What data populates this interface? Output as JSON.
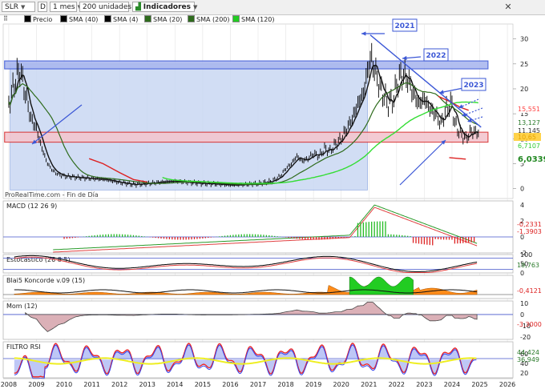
{
  "toolbar": {
    "symbol": "SLR",
    "d_label": "D",
    "period": "1 mes",
    "units": "200 unidades",
    "indicators": "Indicadores"
  },
  "legend": [
    {
      "label": "Precio",
      "color": "#000000"
    },
    {
      "label": "SMA (40)",
      "color": "#000000"
    },
    {
      "label": "SMA (4)",
      "color": "#000000"
    },
    {
      "label": "SMA (20)",
      "color": "#2e6b1c"
    },
    {
      "label": "SMA (200)",
      "color": "#2e6b1c"
    },
    {
      "label": "SMA (120)",
      "color": "#22cc22"
    }
  ],
  "watermark": "ProRealTime.com - Fin de Día",
  "annotations": [
    "2021",
    "2022",
    "2023"
  ],
  "chart_data": [
    {
      "type": "line",
      "name": "price",
      "ylim": [
        -2,
        33
      ],
      "yticks": [
        0,
        5,
        10,
        15,
        20,
        25,
        30
      ],
      "x": [
        2008.0,
        2008.2,
        2008.4,
        2008.6,
        2008.8,
        2009.0,
        2009.2,
        2009.4,
        2009.6,
        2009.8,
        2010.0,
        2010.5,
        2011.0,
        2011.5,
        2012.0,
        2012.5,
        2013.0,
        2013.5,
        2014.0,
        2014.5,
        2015.0,
        2015.5,
        2016.0,
        2016.5,
        2017.0,
        2017.5,
        2017.8,
        2018.0,
        2018.2,
        2018.4,
        2018.6,
        2018.8,
        2019.0,
        2019.2,
        2019.4,
        2019.6,
        2019.8,
        2020.0,
        2020.2,
        2020.4,
        2020.6,
        2020.8,
        2020.9,
        2021.0,
        2021.1,
        2021.3,
        2021.5,
        2021.7,
        2021.9,
        2022.0,
        2022.2,
        2022.4,
        2022.6,
        2022.8,
        2023.0,
        2023.2,
        2023.4,
        2023.6,
        2023.8,
        2024.0,
        2024.1,
        2024.3,
        2024.5,
        2024.7,
        2024.9
      ],
      "price": [
        17,
        21,
        24,
        19,
        14,
        12,
        8,
        5,
        3.5,
        2.8,
        2.5,
        2.2,
        2.0,
        1.8,
        1.2,
        0.8,
        1.0,
        1.3,
        1.5,
        1.2,
        1.0,
        0.9,
        0.7,
        0.8,
        1.0,
        1.5,
        2.5,
        4,
        5,
        6.5,
        5.5,
        6,
        7,
        6.5,
        8,
        7.5,
        9,
        10,
        12,
        14,
        17,
        19,
        22,
        25,
        26,
        22,
        19,
        17,
        18,
        21,
        23,
        22,
        19,
        17,
        18,
        16,
        15,
        13,
        16,
        17,
        13,
        11,
        10,
        11.5,
        11.2
      ],
      "value_labels_right": [
        "15,551",
        "13,127",
        "11,145",
        "10,65",
        "6,7107",
        "6,0339"
      ],
      "arrow_labels": []
    },
    {
      "type": "bar",
      "name": "MACD (12 26 9)",
      "ylim": [
        -2,
        4.5
      ],
      "yticks": [
        4,
        2,
        0,
        -2
      ],
      "value_labels_right": [
        "-0,2331",
        "-1,3903"
      ]
    },
    {
      "type": "line",
      "name": "Estocástico (26 8 5)",
      "ylim": [
        0,
        100
      ],
      "yticks": [
        100,
        50,
        0
      ],
      "value_labels_right": [
        "19,763"
      ]
    },
    {
      "type": "area",
      "name": "Blai5 Koncorde v.09 (15)",
      "value_labels_right": [
        "-0,4121"
      ]
    },
    {
      "type": "area",
      "name": "Mom (12)",
      "ylim": [
        -22,
        12
      ],
      "yticks": [
        10,
        0,
        -10,
        -20
      ],
      "value_labels_right": [
        "-3,3000"
      ]
    },
    {
      "type": "line",
      "name": "FILTRO RSI",
      "ylim": [
        10,
        85
      ],
      "yticks": [
        60,
        40,
        20
      ],
      "value_labels_right": [
        "44,424",
        "36,949"
      ]
    }
  ],
  "x_axis": [
    "2008",
    "2009",
    "2010",
    "2011",
    "2012",
    "2013",
    "2014",
    "2015",
    "2016",
    "2017",
    "2018",
    "2019",
    "2020",
    "2021",
    "2022",
    "2023",
    "2024",
    "2025",
    "2026"
  ],
  "y_axis_labels": {
    "macd": [
      "4",
      "2",
      "0",
      "-2"
    ],
    "stoch": [
      "100",
      "50",
      "0"
    ],
    "mom": [
      "10",
      "0",
      "-10",
      "-20"
    ],
    "rsi": [
      "60",
      "40",
      "20"
    ]
  },
  "colors": {
    "price": "#000000",
    "sma20": "#2e6b1c",
    "sma120": "#33dd33",
    "sma200": "#dd2222",
    "zone_blue": "#3b57d6",
    "zone_red": "#d83030",
    "macd_pos": "#22bb22",
    "macd_neg": "#dd2222",
    "koncorde_orange": "#ff8c1a",
    "koncorde_green": "#22cc22",
    "rsi_blue": "#3344ee",
    "rsi_red": "#ee2222",
    "rsi_yellow": "#eeee22"
  }
}
